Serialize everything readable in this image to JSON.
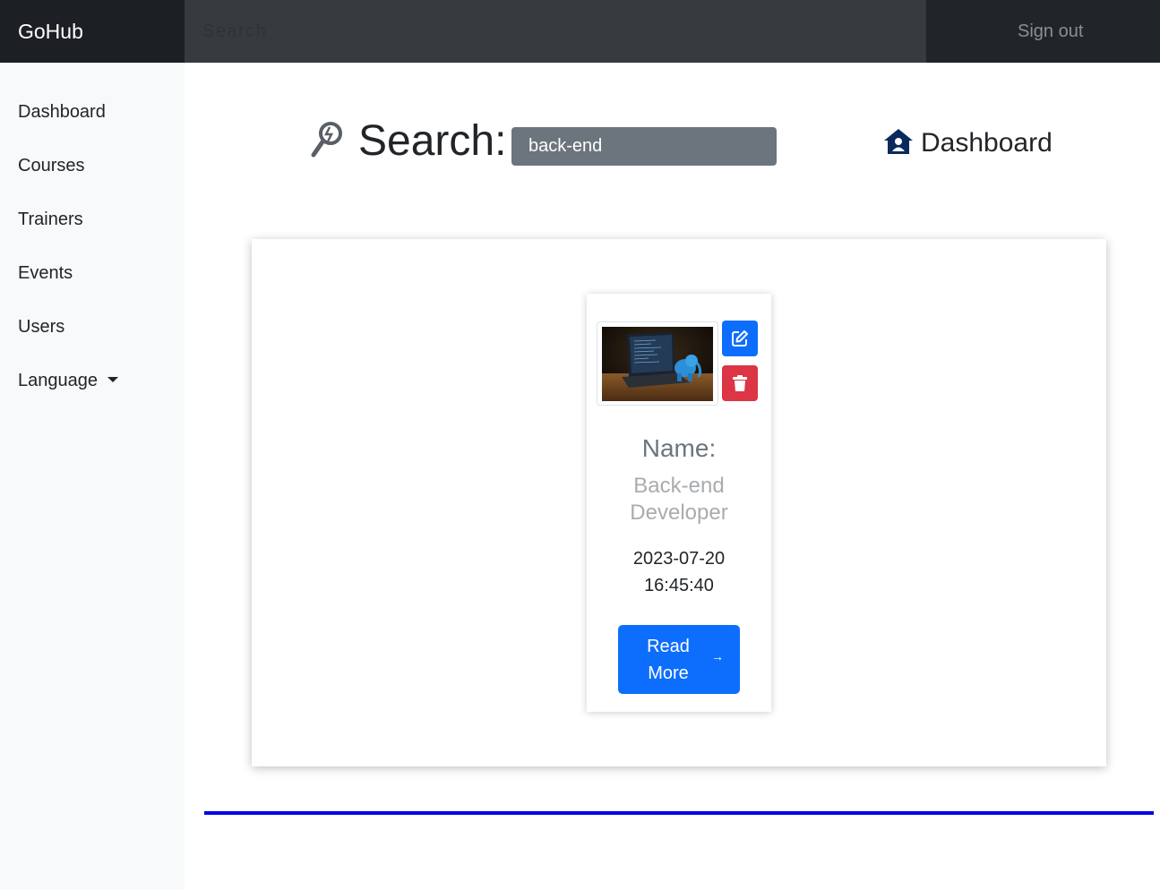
{
  "navbar": {
    "brand": "GoHub",
    "search_placeholder": "Search",
    "signout_label": "Sign out"
  },
  "sidebar": {
    "items": [
      {
        "label": "Dashboard"
      },
      {
        "label": "Courses"
      },
      {
        "label": "Trainers"
      },
      {
        "label": "Events"
      },
      {
        "label": "Users"
      },
      {
        "label": "Language"
      }
    ]
  },
  "header": {
    "title": "Search:",
    "search_value": "back-end",
    "dashboard_link": "Dashboard",
    "icons": {
      "title": "magnifier-icon",
      "dashboard": "house-user-icon"
    }
  },
  "results": {
    "cards": [
      {
        "image_alt": "laptop with blue elephant",
        "name_label": "Name:",
        "name_value": "Back-end Developer",
        "date": "2023-07-20 16:45:40",
        "read_more": "Read More",
        "icons": {
          "edit": "edit-icon",
          "delete": "trash-icon",
          "read_more": "arrow-right-icon"
        }
      }
    ]
  },
  "colors": {
    "navbar": "#212529",
    "brand_bg": "#1c1f23",
    "primary": "#0d6efd",
    "danger": "#dc3545",
    "secondary": "#6c757d",
    "divider": "#0000e6",
    "dashboard_icon": "#0a2a5e"
  }
}
